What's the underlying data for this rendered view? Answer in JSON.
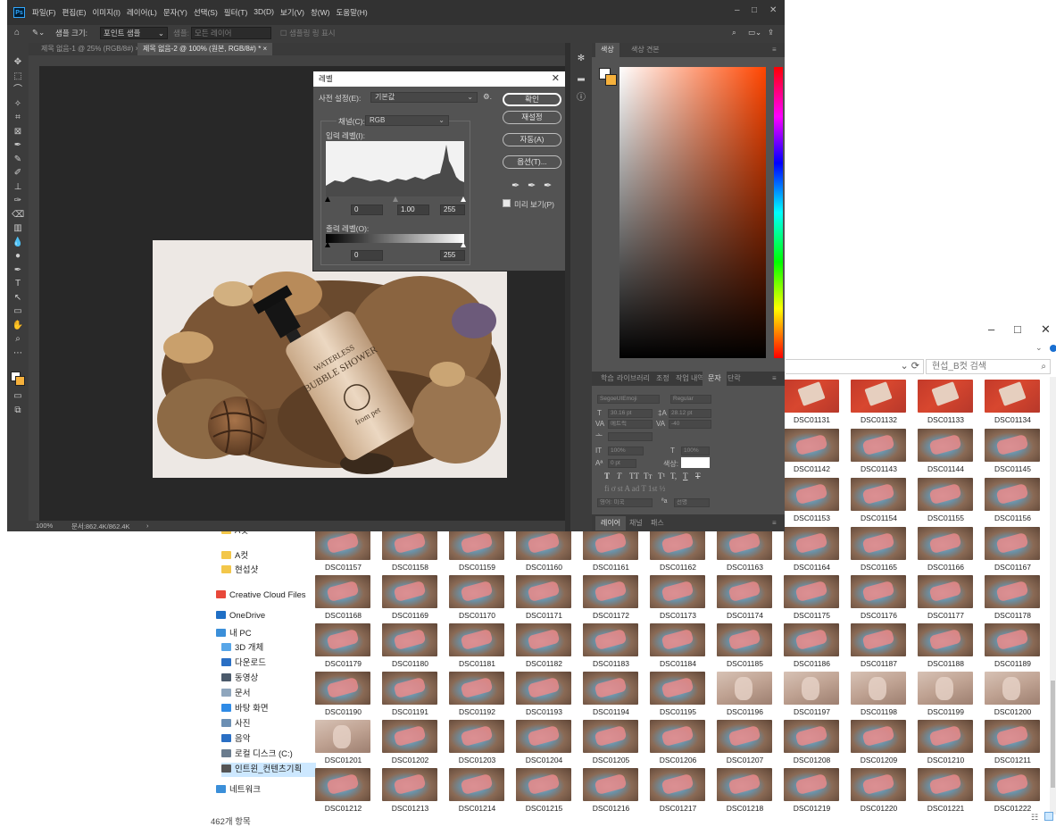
{
  "explorer": {
    "window_controls": [
      "–",
      "□",
      "✕"
    ],
    "address_refresh": "⟳",
    "search_placeholder": "현섭_B컷 검색",
    "status": "462개 항목",
    "sidebar": [
      {
        "label": "A컷",
        "icon": "folder-icon",
        "color": "#f3c74a"
      },
      {
        "label": "A컷",
        "icon": "folder-icon",
        "color": "#f3c74a"
      },
      {
        "label": "현섭샷",
        "icon": "folder-icon",
        "color": "#f3c74a"
      },
      {
        "label": "Creative Cloud Files",
        "icon": "creative-cloud-icon",
        "color": "#e8483a"
      },
      {
        "label": "OneDrive",
        "icon": "onedrive-icon",
        "color": "#1f6fc5"
      },
      {
        "label": "내 PC",
        "icon": "pc-icon",
        "color": "#3b8fd9"
      },
      {
        "label": "3D 개체",
        "icon": "3d-objects-icon",
        "color": "#58a6e8"
      },
      {
        "label": "다운로드",
        "icon": "download-icon",
        "color": "#2a6fc4"
      },
      {
        "label": "동영상",
        "icon": "video-icon",
        "color": "#4b5a6b"
      },
      {
        "label": "문서",
        "icon": "document-icon",
        "color": "#8fa6bd"
      },
      {
        "label": "바탕 화면",
        "icon": "desktop-icon",
        "color": "#2f8be6"
      },
      {
        "label": "사진",
        "icon": "pictures-icon",
        "color": "#6c8fb3"
      },
      {
        "label": "음악",
        "icon": "music-icon",
        "color": "#2a6fc4"
      },
      {
        "label": "로컬 디스크 (C:)",
        "icon": "disk-icon",
        "color": "#6a7c8e"
      },
      {
        "label": "인트윈_컨텐츠기획",
        "icon": "network-drive-icon",
        "color": "#555555"
      },
      {
        "label": "네트워크",
        "icon": "network-icon",
        "color": "#3b8fd9"
      }
    ],
    "rows_partial": [
      {
        "names": [
          "DSC01131",
          "DSC01132",
          "DSC01133",
          "DSC01134"
        ],
        "kinds": [
          "red",
          "red",
          "red",
          "red"
        ]
      },
      {
        "names": [
          "DSC01142",
          "DSC01143",
          "DSC01144",
          "DSC01145"
        ],
        "kinds": [
          "plate",
          "plate",
          "plate",
          "plate"
        ]
      },
      {
        "names": [
          "DSC01153",
          "DSC01154",
          "DSC01155",
          "DSC01156"
        ],
        "kinds": [
          "plate",
          "plate",
          "plate",
          "plate"
        ]
      }
    ],
    "rows_full": [
      {
        "names": [
          "DSC01157",
          "DSC01158",
          "DSC01159",
          "DSC01160",
          "DSC01161",
          "DSC01162",
          "DSC01163",
          "DSC01164",
          "DSC01165",
          "DSC01166",
          "DSC01167"
        ],
        "kinds": [
          "plate",
          "plate",
          "plate",
          "plate",
          "plate",
          "plate",
          "plate",
          "plate",
          "plate",
          "plate",
          "plate"
        ]
      },
      {
        "names": [
          "DSC01168",
          "DSC01169",
          "DSC01170",
          "DSC01171",
          "DSC01172",
          "DSC01173",
          "DSC01174",
          "DSC01175",
          "DSC01176",
          "DSC01177",
          "DSC01178"
        ],
        "kinds": [
          "plate",
          "plate",
          "plate",
          "plate",
          "plate",
          "plate",
          "plate",
          "plate",
          "plate",
          "plate",
          "plate"
        ]
      },
      {
        "names": [
          "DSC01179",
          "DSC01180",
          "DSC01181",
          "DSC01182",
          "DSC01183",
          "DSC01184",
          "DSC01185",
          "DSC01186",
          "DSC01187",
          "DSC01188",
          "DSC01189"
        ],
        "kinds": [
          "plate",
          "plate",
          "plate",
          "plate",
          "plate",
          "plate",
          "plate",
          "plate",
          "plate",
          "plate",
          "plate"
        ]
      },
      {
        "names": [
          "DSC01190",
          "DSC01191",
          "DSC01192",
          "DSC01193",
          "DSC01194",
          "DSC01195",
          "DSC01196",
          "DSC01197",
          "DSC01198",
          "DSC01199",
          "DSC01200"
        ],
        "kinds": [
          "plate",
          "plate",
          "plate",
          "plate",
          "plate",
          "plate",
          "skin",
          "skin",
          "skin",
          "skin",
          "skin"
        ]
      },
      {
        "names": [
          "DSC01201",
          "DSC01202",
          "DSC01203",
          "DSC01204",
          "DSC01205",
          "DSC01206",
          "DSC01207",
          "DSC01208",
          "DSC01209",
          "DSC01210",
          "DSC01211"
        ],
        "kinds": [
          "skin",
          "plate",
          "plate",
          "plate",
          "plate",
          "plate",
          "plate",
          "plate",
          "plate",
          "plate",
          "plate"
        ]
      },
      {
        "names": [
          "DSC01212",
          "DSC01213",
          "DSC01214",
          "DSC01215",
          "DSC01216",
          "DSC01217",
          "DSC01218",
          "DSC01219",
          "DSC01220",
          "DSC01221",
          "DSC01222"
        ],
        "kinds": [
          "plate",
          "plate",
          "plate",
          "plate",
          "plate",
          "plate",
          "plate",
          "plate",
          "plate",
          "plate",
          "plate"
        ]
      }
    ]
  },
  "photoshop": {
    "logo": "Ps",
    "menus": [
      "파일(F)",
      "편집(E)",
      "이미지(I)",
      "레이어(L)",
      "문자(Y)",
      "선택(S)",
      "필터(T)",
      "3D(D)",
      "보기(V)",
      "창(W)",
      "도움말(H)"
    ],
    "window_controls": [
      "–",
      "□",
      "✕"
    ],
    "options": {
      "sample_size_label": "샘플 크기:",
      "sample_size_value": "포인트 샘플",
      "sample_label": "샘플:",
      "sample_value": "모든 레이어",
      "show_ring": "샘플링 링 표시"
    },
    "tabs": [
      {
        "label": "제목 없음-1 @ 25% (RGB/8#)",
        "active": false
      },
      {
        "label": "제목 없음-2 @ 100% (원본, RGB/8#) *",
        "active": true
      }
    ],
    "status": {
      "zoom": "100%",
      "doc": "문서:862.4K/862.4K"
    },
    "color_panel_tabs": [
      "색상",
      "색상 견본"
    ],
    "char_panel_tabs": [
      "학습",
      "라이브러리",
      "조정",
      "작업 내역",
      "문자",
      "단락"
    ],
    "char": {
      "font": "SegoeUIEmoji",
      "style": "Regular",
      "size": "30.16 pt",
      "leading": "28.12 pt",
      "kerning": "메트릭",
      "tracking": "-40",
      "vscale": "100%",
      "hscale": "100%",
      "baseline": "0 pt",
      "color_label": "색상:",
      "lang": "영어: 미국",
      "aa": "선명"
    },
    "layers_tabs": [
      "레이어",
      "채널",
      "패스"
    ],
    "product": {
      "brand_line1": "WATERLESS",
      "brand_line2": "BUBBLE SHOWER",
      "logo": "from pet"
    },
    "levels": {
      "title": "레벨",
      "preset_label": "사전 설정(E):",
      "preset_value": "기본값",
      "channel_label": "채널(C):",
      "channel_value": "RGB",
      "input_label": "입력 레벨(I):",
      "output_label": "출력 레벨(O):",
      "input_values": [
        "0",
        "1.00",
        "255"
      ],
      "output_values": [
        "0",
        "255"
      ],
      "buttons": [
        "확인",
        "재설정",
        "자동(A)",
        "옵션(T)..."
      ],
      "preview": "미리 보기(P)"
    }
  }
}
